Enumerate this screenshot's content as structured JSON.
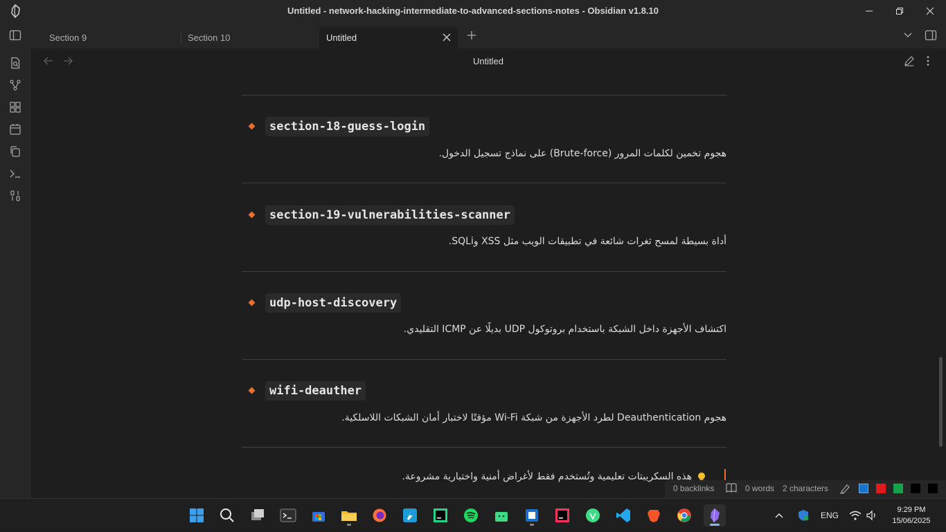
{
  "window": {
    "title": "Untitled - network-hacking-intermediate-to-advanced-sections-notes - Obsidian v1.8.10"
  },
  "tabs": [
    {
      "label": "Section 9"
    },
    {
      "label": "Section 10"
    },
    {
      "label": "Untitled"
    }
  ],
  "view": {
    "title": "Untitled"
  },
  "entries": [
    {
      "name": "section-18-guess-login",
      "description": "هجوم تخمين لكلمات المرور (Brute-force) على نماذج تسجيل الدخول."
    },
    {
      "name": "section-19-vulnerabilities-scanner",
      "description": "أداة بسيطة لمسح ثغرات شائعة في تطبيقات الويب مثل XSS وSQLi."
    },
    {
      "name": "udp-host-discovery",
      "description": "اكتشاف الأجهزة داخل الشبكة باستخدام بروتوكول UDP بديلًا عن ICMP التقليدي."
    },
    {
      "name": "wifi-deauther",
      "description": "هجوم Deauthentication لطرد الأجهزة من شبكة Wi-Fi مؤقتًا لاختبار أمان الشبكات اللاسلكية."
    }
  ],
  "callout": {
    "text": "هذه السكريبتات تعليمية وتُستخدم فقط لأغراض أمنية واختبارية مشروعة."
  },
  "statusbar": {
    "backlinks": "0 backlinks",
    "words": "0 words",
    "characters": "2 characters",
    "colors": [
      "#1a73c8",
      "#e11b1b",
      "#15a34a",
      "#000000",
      "#000000"
    ]
  },
  "taskbar": {
    "language": "ENG",
    "time": "9:29 PM",
    "date": "15/06/2025"
  },
  "colors": {
    "accent": "#e8702a",
    "background": "#1e1e1e",
    "chrome": "#262626"
  }
}
